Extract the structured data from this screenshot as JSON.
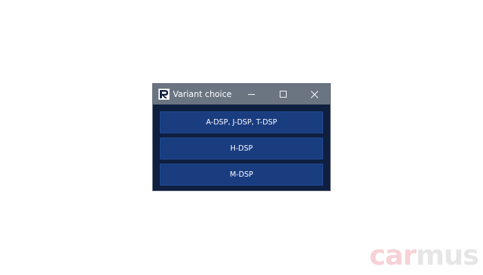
{
  "window": {
    "title": "Variant choice",
    "icons": {
      "app": "app-logo-icon",
      "minimize": "minimize-icon",
      "maximize": "maximize-icon",
      "close": "close-icon"
    }
  },
  "variants": [
    {
      "label": "A-DSP, J-DSP, T-DSP"
    },
    {
      "label": "H-DSP"
    },
    {
      "label": "M-DSP"
    }
  ],
  "watermark": {
    "part1": "car",
    "part2": "mus"
  },
  "colors": {
    "titlebar": "#6b7582",
    "dialog_background": "#0f1f3f",
    "button_background": "#1a3d80",
    "button_text": "#ffffff"
  }
}
